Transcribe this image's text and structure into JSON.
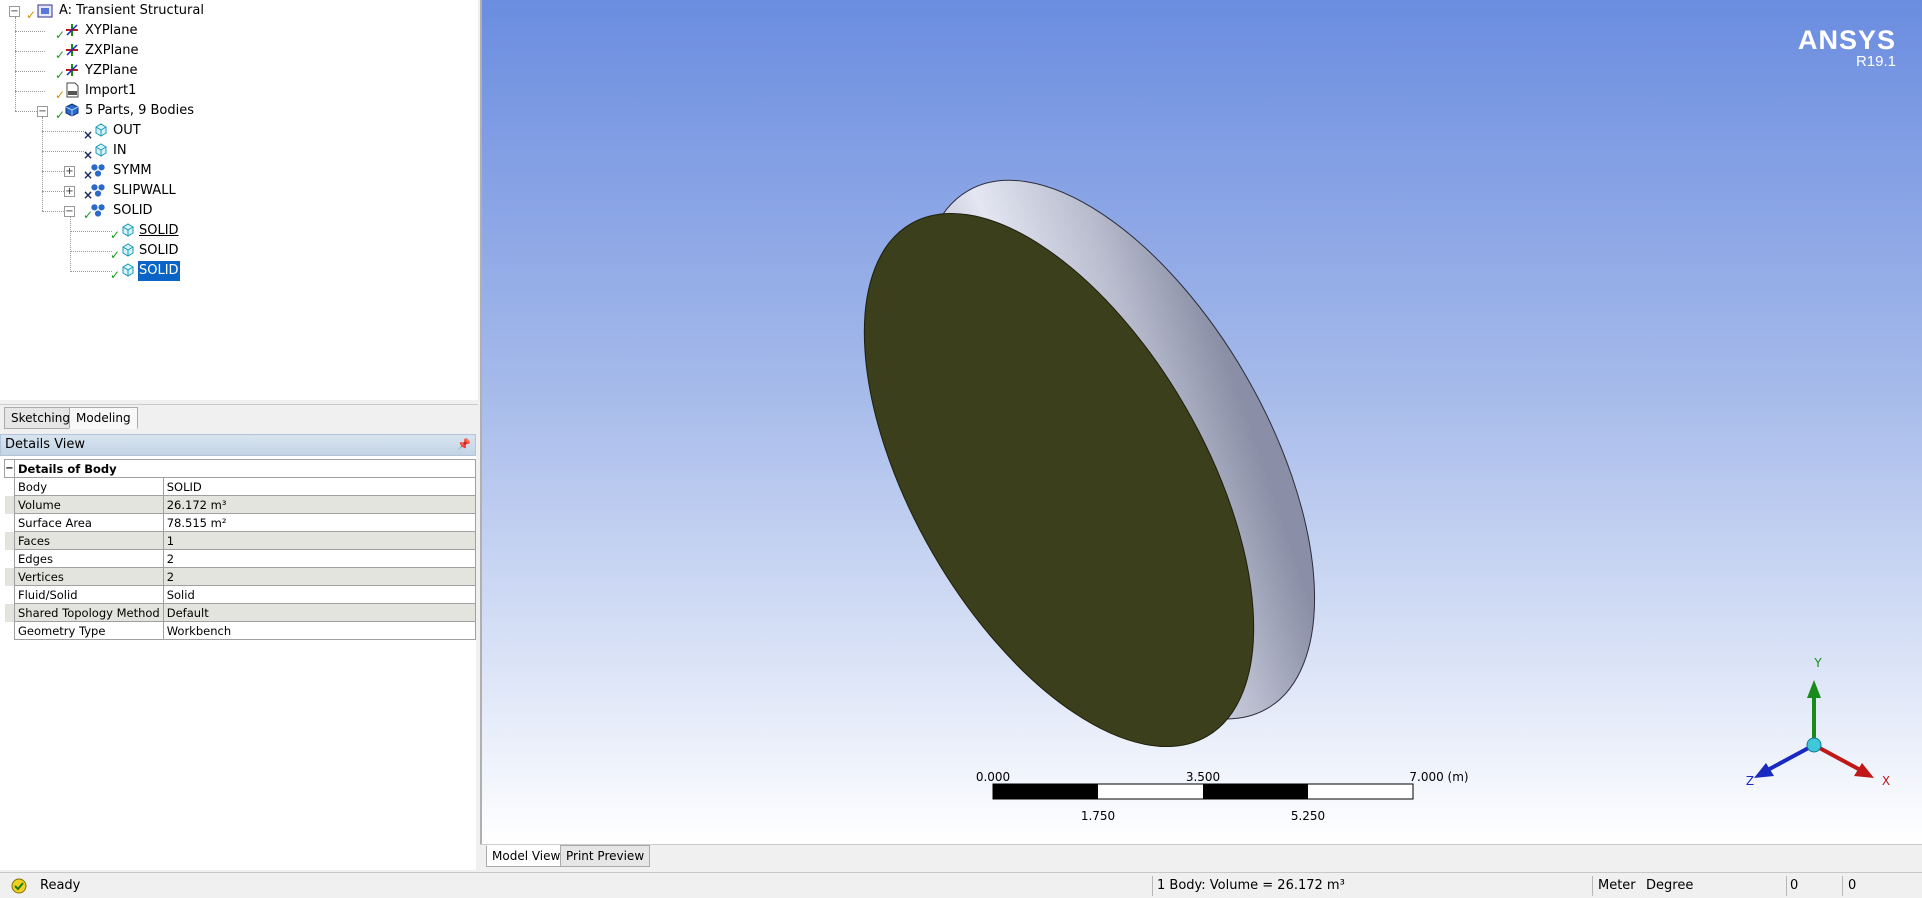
{
  "tree": {
    "root": "A: Transient Structural",
    "planes": [
      "XYPlane",
      "ZXPlane",
      "YZPlane"
    ],
    "import": "Import1",
    "parts_node": "5 Parts, 9 Bodies",
    "parts": [
      "OUT",
      "IN",
      "SYMM",
      "SLIPWALL",
      "SOLID"
    ],
    "solid_bodies": [
      "SOLID",
      "SOLID",
      "SOLID"
    ]
  },
  "mode_tabs": {
    "sketching": "Sketching",
    "modeling": "Modeling"
  },
  "details": {
    "panel_title": "Details View",
    "section": "Details of Body",
    "rows": [
      {
        "key": "Body",
        "value": "SOLID"
      },
      {
        "key": "Volume",
        "value": "26.172 m³"
      },
      {
        "key": "Surface Area",
        "value": "78.515 m²"
      },
      {
        "key": "Faces",
        "value": "1"
      },
      {
        "key": "Edges",
        "value": "2"
      },
      {
        "key": "Vertices",
        "value": "2"
      },
      {
        "key": "Fluid/Solid",
        "value": "Solid"
      },
      {
        "key": "Shared Topology Method",
        "value": "Default"
      },
      {
        "key": "Geometry Type",
        "value": "Workbench"
      }
    ]
  },
  "viewport": {
    "brand": "ANSYS",
    "version": "R19.1",
    "scale_labels_top": [
      "0.000",
      "3.500",
      "7.000 (m)"
    ],
    "scale_labels_bottom": [
      "1.750",
      "5.250"
    ],
    "axes": {
      "x": "X",
      "y": "Y",
      "z": "Z"
    },
    "colors": {
      "disk_face": "#3c3f1b",
      "axis_x": "#c01818",
      "axis_y": "#1a8a1a",
      "axis_z": "#1a2ac0"
    }
  },
  "view_tabs": {
    "model_view": "Model View",
    "print_preview": "Print Preview"
  },
  "status": {
    "text": "Ready",
    "selection": "1 Body: Volume = 26.172 m³",
    "length_unit": "Meter",
    "angle_unit": "Degree",
    "value1": "0",
    "value2": "0"
  }
}
